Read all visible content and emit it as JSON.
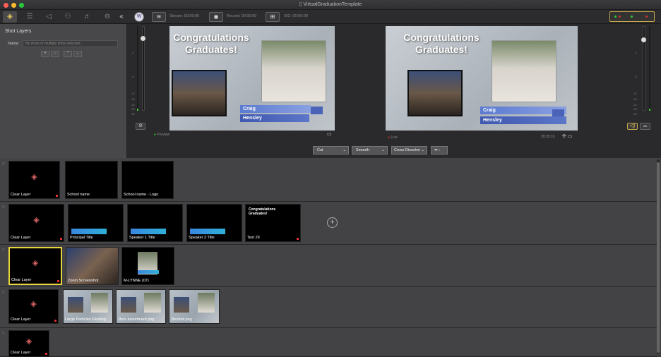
{
  "window": {
    "title": "VirtualGraduationTemplate"
  },
  "toolbar": {
    "stream": "Stream: 00:00:00",
    "record": "Record: 00:00:00",
    "iso": "ISO: 00:00:00"
  },
  "left_panel": {
    "title": "Shot Layers",
    "name_label": "Name:",
    "name_placeholder": "No shots or multiple shots selected"
  },
  "preview": {
    "title": "Congratulations Graduates!",
    "label1": "Craig",
    "label2": "Hensley",
    "tag": "Preview"
  },
  "live": {
    "title": "Congratulations Graduates!",
    "label1": "Craig",
    "label2": "Hensley",
    "tag": "Live",
    "time": "28:05:16"
  },
  "meters": {
    "ticks": [
      "0",
      "-6",
      "-12",
      "-18",
      "-24",
      "-30",
      "-36"
    ]
  },
  "transition": {
    "cut": "Cut",
    "smooth": "Smooth",
    "cross": "Cross Dissolve"
  },
  "layers": [
    {
      "shots": [
        {
          "label": "Clear Layer",
          "type": "clear"
        },
        {
          "label": "School name",
          "type": "black"
        },
        {
          "label": "School name - Logo",
          "type": "black"
        }
      ]
    },
    {
      "shots": [
        {
          "label": "Clear Layer",
          "type": "clear"
        },
        {
          "label": "Principal Title",
          "type": "lower"
        },
        {
          "label": "Speaker 1 Title",
          "type": "lower"
        },
        {
          "label": "Speaker 2 Title",
          "type": "lower"
        },
        {
          "label": "Text 29",
          "type": "text",
          "caption": "Congratulations Graduates!"
        }
      ]
    },
    {
      "shots": [
        {
          "label": "Clear Layer",
          "type": "clear",
          "selected": true
        },
        {
          "label": "Zoom Screenshot",
          "type": "photo"
        },
        {
          "label": "M-LYNNE (07)",
          "type": "photo2"
        }
      ]
    },
    {
      "shots": [
        {
          "label": "Clear Layer",
          "type": "clear"
        },
        {
          "label": "Large Particles Floating",
          "type": "scene"
        },
        {
          "label": "2box assortment.png",
          "type": "scene"
        },
        {
          "label": "2boxtall.png",
          "type": "scene"
        }
      ]
    },
    {
      "shots": [
        {
          "label": "Clear Layer",
          "type": "clear"
        }
      ]
    }
  ]
}
